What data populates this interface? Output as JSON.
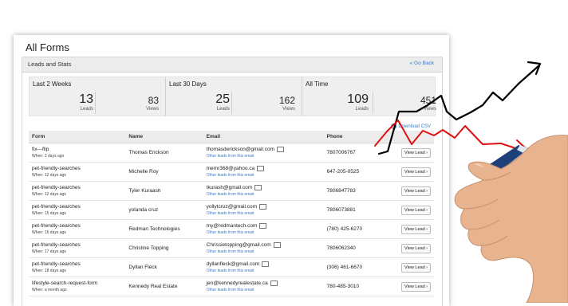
{
  "page_title": "All Forms",
  "panel": {
    "title": "Leads and Stats",
    "go_back": "« Go Back"
  },
  "stats": [
    {
      "label": "Last 2 Weeks",
      "leads": "13",
      "views": "83"
    },
    {
      "label": "Last 30 Days",
      "leads": "25",
      "views": "162"
    },
    {
      "label": "All Time",
      "leads": "109",
      "views": "451"
    }
  ],
  "stat_sub": {
    "leads": "Leads",
    "views": "Views"
  },
  "download": "Download CSV",
  "table": {
    "headers": [
      "Form",
      "Name",
      "Email",
      "Phone",
      ""
    ],
    "other_leads": "Other leads from this email",
    "view_label": "View Lead ›",
    "rows": [
      {
        "form": "fix---flip",
        "when": "When: 2 days ago",
        "name": "Thomas Erickson",
        "email": "thomasderickson@gmail.com",
        "phone": "7807006767"
      },
      {
        "form": "pet-friendly-searches",
        "when": "When: 12 days ago",
        "name": "Michelle Roy",
        "email": "memr368@yahoo.ca",
        "phone": "647-205-0525"
      },
      {
        "form": "pet-friendly-searches",
        "when": "When: 12 days ago",
        "name": "Tyler Kuraash",
        "email": "tkurash@gmail.com",
        "phone": "7806847783"
      },
      {
        "form": "pet-friendly-searches",
        "when": "When: 15 days ago",
        "name": "yolanda cruz",
        "email": "yollytcruz@gmail.com",
        "phone": "7806073881"
      },
      {
        "form": "pet-friendly-searches",
        "when": "When: 16 days ago",
        "name": "Redman Technologies",
        "email": "my@redmantech.com",
        "phone": "(780) 425-6270"
      },
      {
        "form": "pet-friendly-searches",
        "when": "When: 17 days ago",
        "name": "Christine Topping",
        "email": "Chrissietopping@gmail.com",
        "phone": "7806062340"
      },
      {
        "form": "pet-friendly-searches",
        "when": "When: 18 days ago",
        "name": "Dyllan Fleck",
        "email": "dyllanfleck@gmail.com",
        "phone": "(306) 461-6670"
      },
      {
        "form": "lifestyle-search-request-form",
        "when": "When: a month ago",
        "name": "Kennedy Real Estate",
        "email": "jen@kennedyrealestate.ca",
        "phone": "780-485-3010"
      }
    ]
  },
  "colors": {
    "link": "#3a7bc8",
    "arrow_black": "#000000",
    "arrow_red": "#e01010"
  }
}
